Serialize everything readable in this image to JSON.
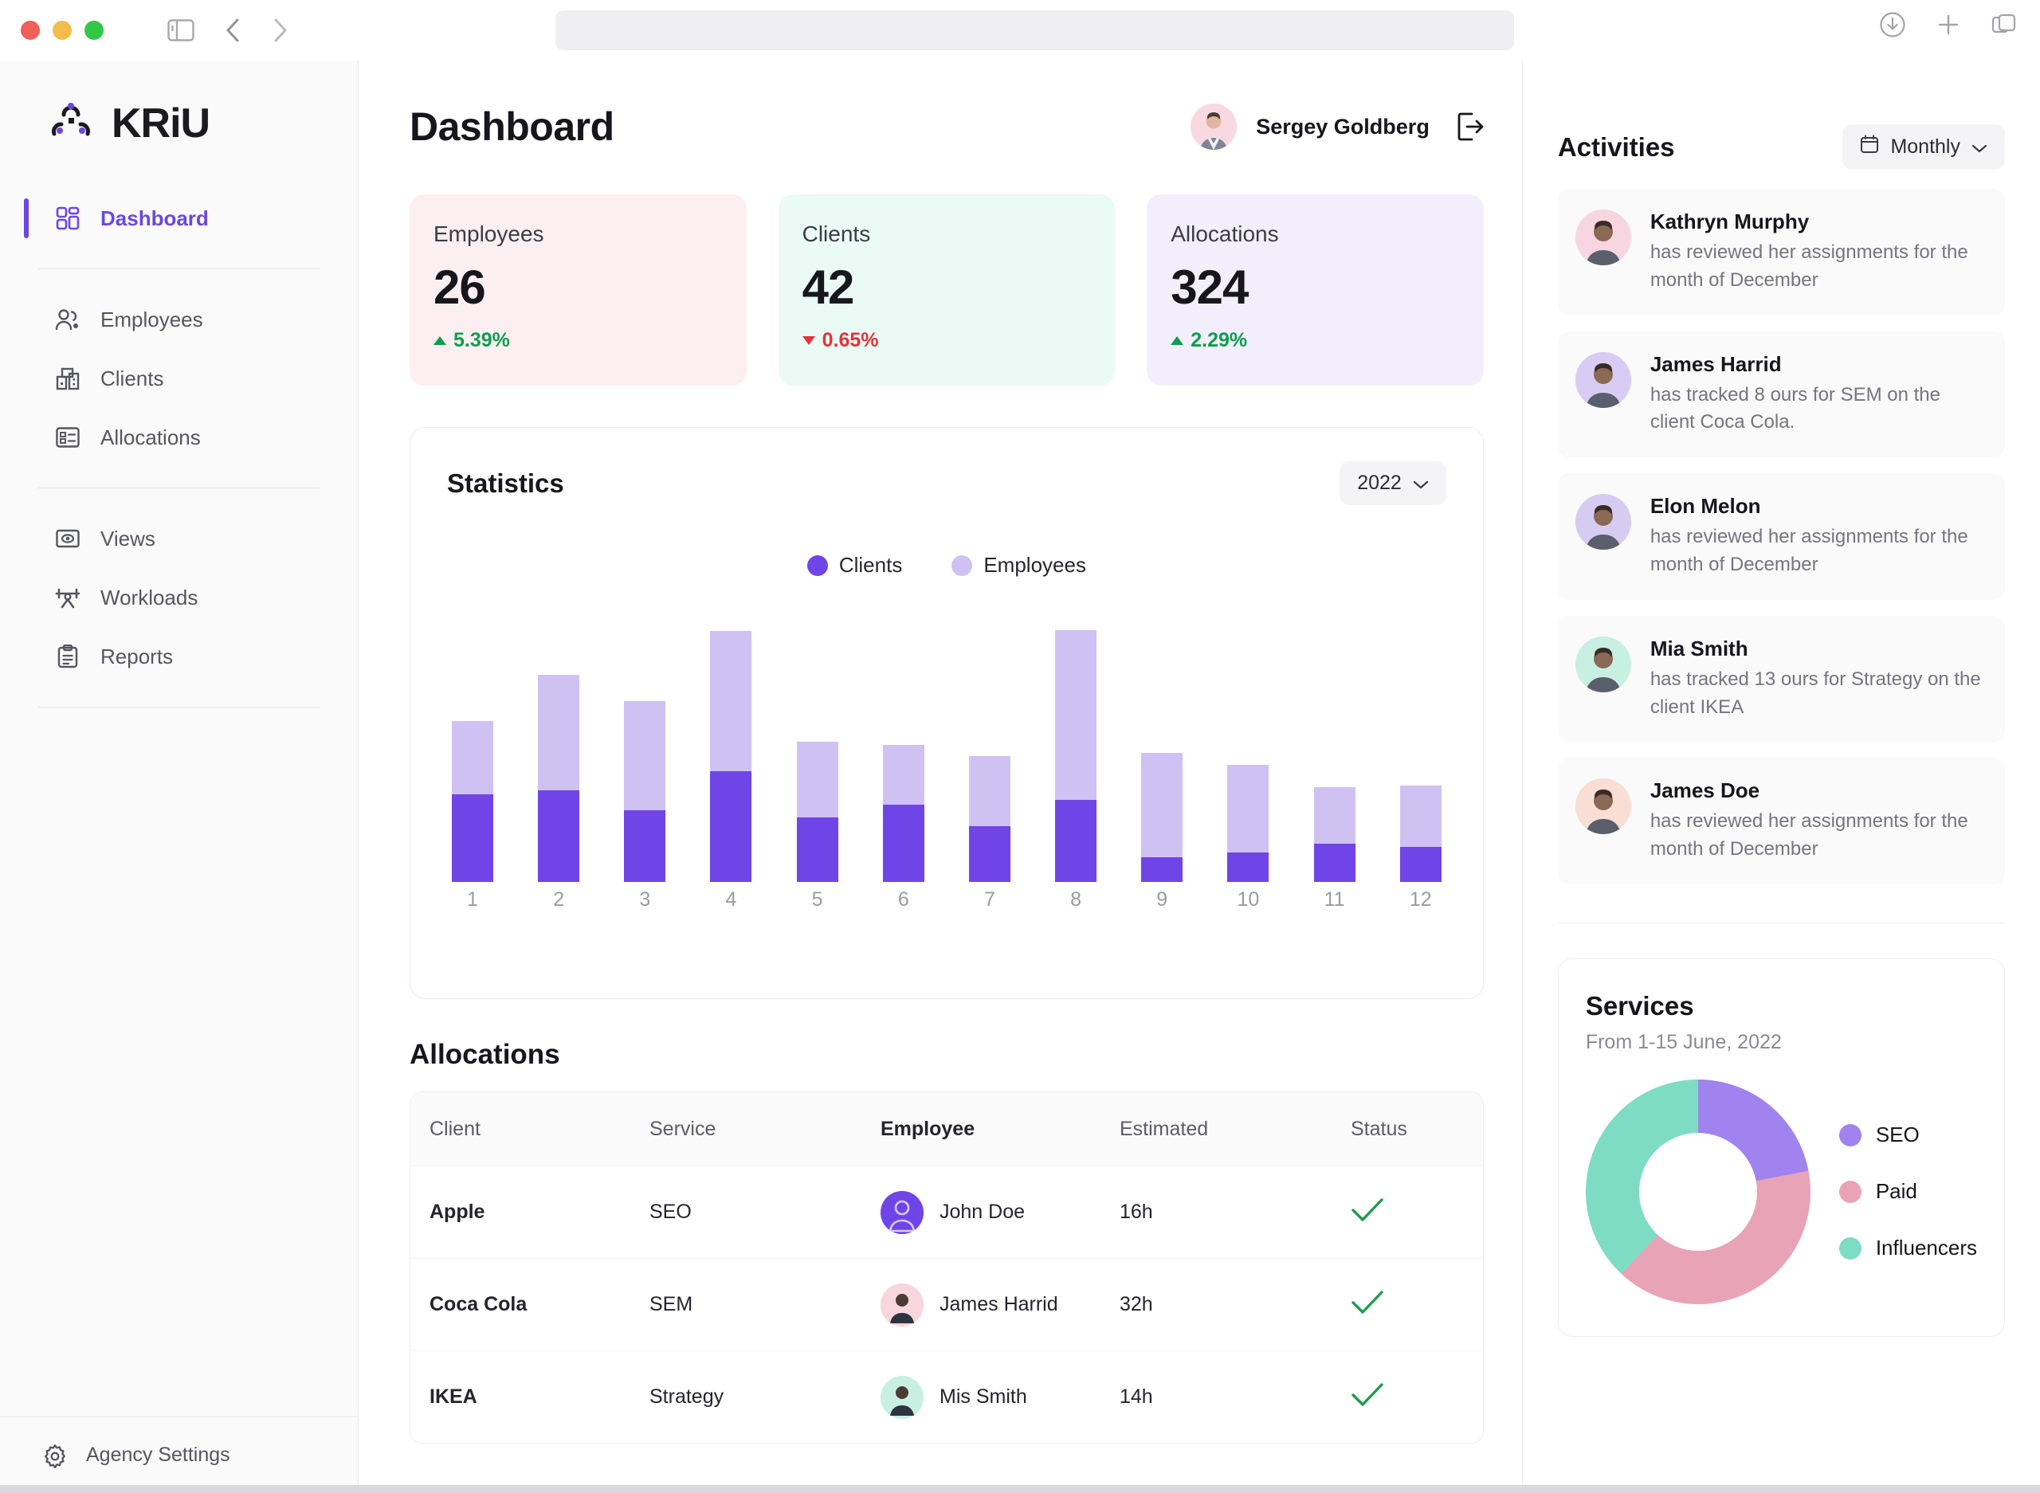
{
  "browser": {
    "traffic_lights": [
      "close",
      "minimize",
      "maximize"
    ],
    "sidebar_toggle_icon": "sidebar-icon",
    "back_icon": "chevron-left-icon",
    "forward_icon": "chevron-right-icon",
    "url_value": "",
    "download_icon": "download-icon",
    "new_tab_icon": "plus-icon",
    "tabs_icon": "tabs-overview-icon"
  },
  "sidebar": {
    "logo_text": "KRiU",
    "logo_icon": "kriu-mark-icon",
    "primary_items": [
      {
        "label": "Dashboard",
        "icon": "grid-icon",
        "active": true
      },
      {
        "label": "Employees",
        "icon": "users-icon",
        "active": false
      },
      {
        "label": "Clients",
        "icon": "buildings-icon",
        "active": false
      },
      {
        "label": "Allocations",
        "icon": "list-card-icon",
        "active": false
      }
    ],
    "secondary_items": [
      {
        "label": "Views",
        "icon": "eye-icon",
        "active": false
      },
      {
        "label": "Workloads",
        "icon": "barbell-icon",
        "active": false
      },
      {
        "label": "Reports",
        "icon": "clipboard-icon",
        "active": false
      }
    ],
    "footer": {
      "label": "Agency Settings",
      "icon": "gear-icon"
    }
  },
  "header": {
    "page_title": "Dashboard",
    "user_name": "Sergey Goldberg",
    "logout_icon": "logout-icon",
    "avatar_name": "sergey-avatar"
  },
  "kpis": [
    {
      "label": "Employees",
      "value": "26",
      "delta": "5.39%",
      "direction": "up",
      "bg": "#fceff1",
      "delta_color": "#0f9d4f"
    },
    {
      "label": "Clients",
      "value": "42",
      "delta": "0.65%",
      "direction": "down",
      "bg": "#eafaf4",
      "delta_color": "#e0353a"
    },
    {
      "label": "Allocations",
      "value": "324",
      "delta": "2.29%",
      "direction": "up",
      "bg": "#f2eefb",
      "delta_color": "#0f9d4f"
    }
  ],
  "statistics": {
    "title": "Statistics",
    "year_value": "2022",
    "year_caret_icon": "chevron-down-icon"
  },
  "chart_data": [
    {
      "type": "bar",
      "title": "Statistics",
      "stacked": true,
      "xlabel": "",
      "ylabel": "",
      "grid": false,
      "legend_position": "top-center",
      "categories": [
        "1",
        "2",
        "3",
        "4",
        "5",
        "6",
        "7",
        "8",
        "9",
        "10",
        "11",
        "12"
      ],
      "series": [
        {
          "name": "Clients",
          "color": "#7045e8",
          "values": [
            120,
            126,
            98,
            152,
            88,
            106,
            76,
            112,
            34,
            40,
            52,
            48
          ]
        },
        {
          "name": "Employees",
          "color": "#cfc2f2",
          "values": [
            100,
            158,
            150,
            192,
            104,
            82,
            96,
            233,
            143,
            120,
            78,
            84
          ]
        }
      ],
      "ylim": [
        0,
        360
      ]
    },
    {
      "type": "pie",
      "title": "Services",
      "subtitle": "From 1-15 June, 2022",
      "donut": true,
      "legend_position": "right",
      "categories": [
        "SEO",
        "Paid",
        "Influencers"
      ],
      "values": [
        22,
        40,
        38
      ],
      "colors": [
        "#a083ee",
        "#e8a3b6",
        "#7fdcc4"
      ]
    }
  ],
  "allocations": {
    "title": "Allocations",
    "columns": [
      "Client",
      "Service",
      "Employee",
      "Estimated",
      "Status"
    ],
    "rows": [
      {
        "client": "Apple",
        "service": "SEO",
        "employee": "John Doe",
        "estimated": "16h",
        "status": "done",
        "avatar_bg": "#7045e8"
      },
      {
        "client": "Coca Cola",
        "service": "SEM",
        "employee": "James Harrid",
        "estimated": "32h",
        "status": "done",
        "avatar_bg": "#f7d6de"
      },
      {
        "client": "IKEA",
        "service": "Strategy",
        "employee": "Mis Smith",
        "estimated": "14h",
        "status": "done",
        "avatar_bg": "#c7f0e3"
      }
    ],
    "status_icon": "check-icon"
  },
  "activities": {
    "title": "Activities",
    "filter_label": "Monthly",
    "filter_icon": "calendar-icon",
    "filter_caret_icon": "chevron-down-icon",
    "items": [
      {
        "name": "Kathryn Murphy",
        "text": "has reviewed her assignments for the month of December",
        "avatar_bg": "#f7d6e2"
      },
      {
        "name": "James Harrid",
        "text": "has tracked 8 ours for SEM on the  client Coca Cola.",
        "avatar_bg": "#d8ccf5"
      },
      {
        "name": "Elon Melon",
        "text": "has reviewed her assignments for the month of December",
        "avatar_bg": "#d6ccf2"
      },
      {
        "name": "Mia Smith",
        "text": "has tracked 13 ours for Strategy on the  client IKEA",
        "avatar_bg": "#c7f0e3"
      },
      {
        "name": "James Doe",
        "text": "has reviewed her assignments for the month of December",
        "avatar_bg": "#f8ded5"
      }
    ]
  },
  "services": {
    "title": "Services",
    "subtitle": "From 1-15 June, 2022",
    "legend": [
      {
        "label": "SEO",
        "color": "#a083ee"
      },
      {
        "label": "Paid",
        "color": "#e8a3b6"
      },
      {
        "label": "Influencers",
        "color": "#7fdcc4"
      }
    ]
  },
  "theme": {
    "accent": "#6c47e0",
    "bar_dark": "#7045e8",
    "bar_light": "#cfc2f2",
    "success": "#1f9c4d",
    "danger": "#e0353a"
  }
}
